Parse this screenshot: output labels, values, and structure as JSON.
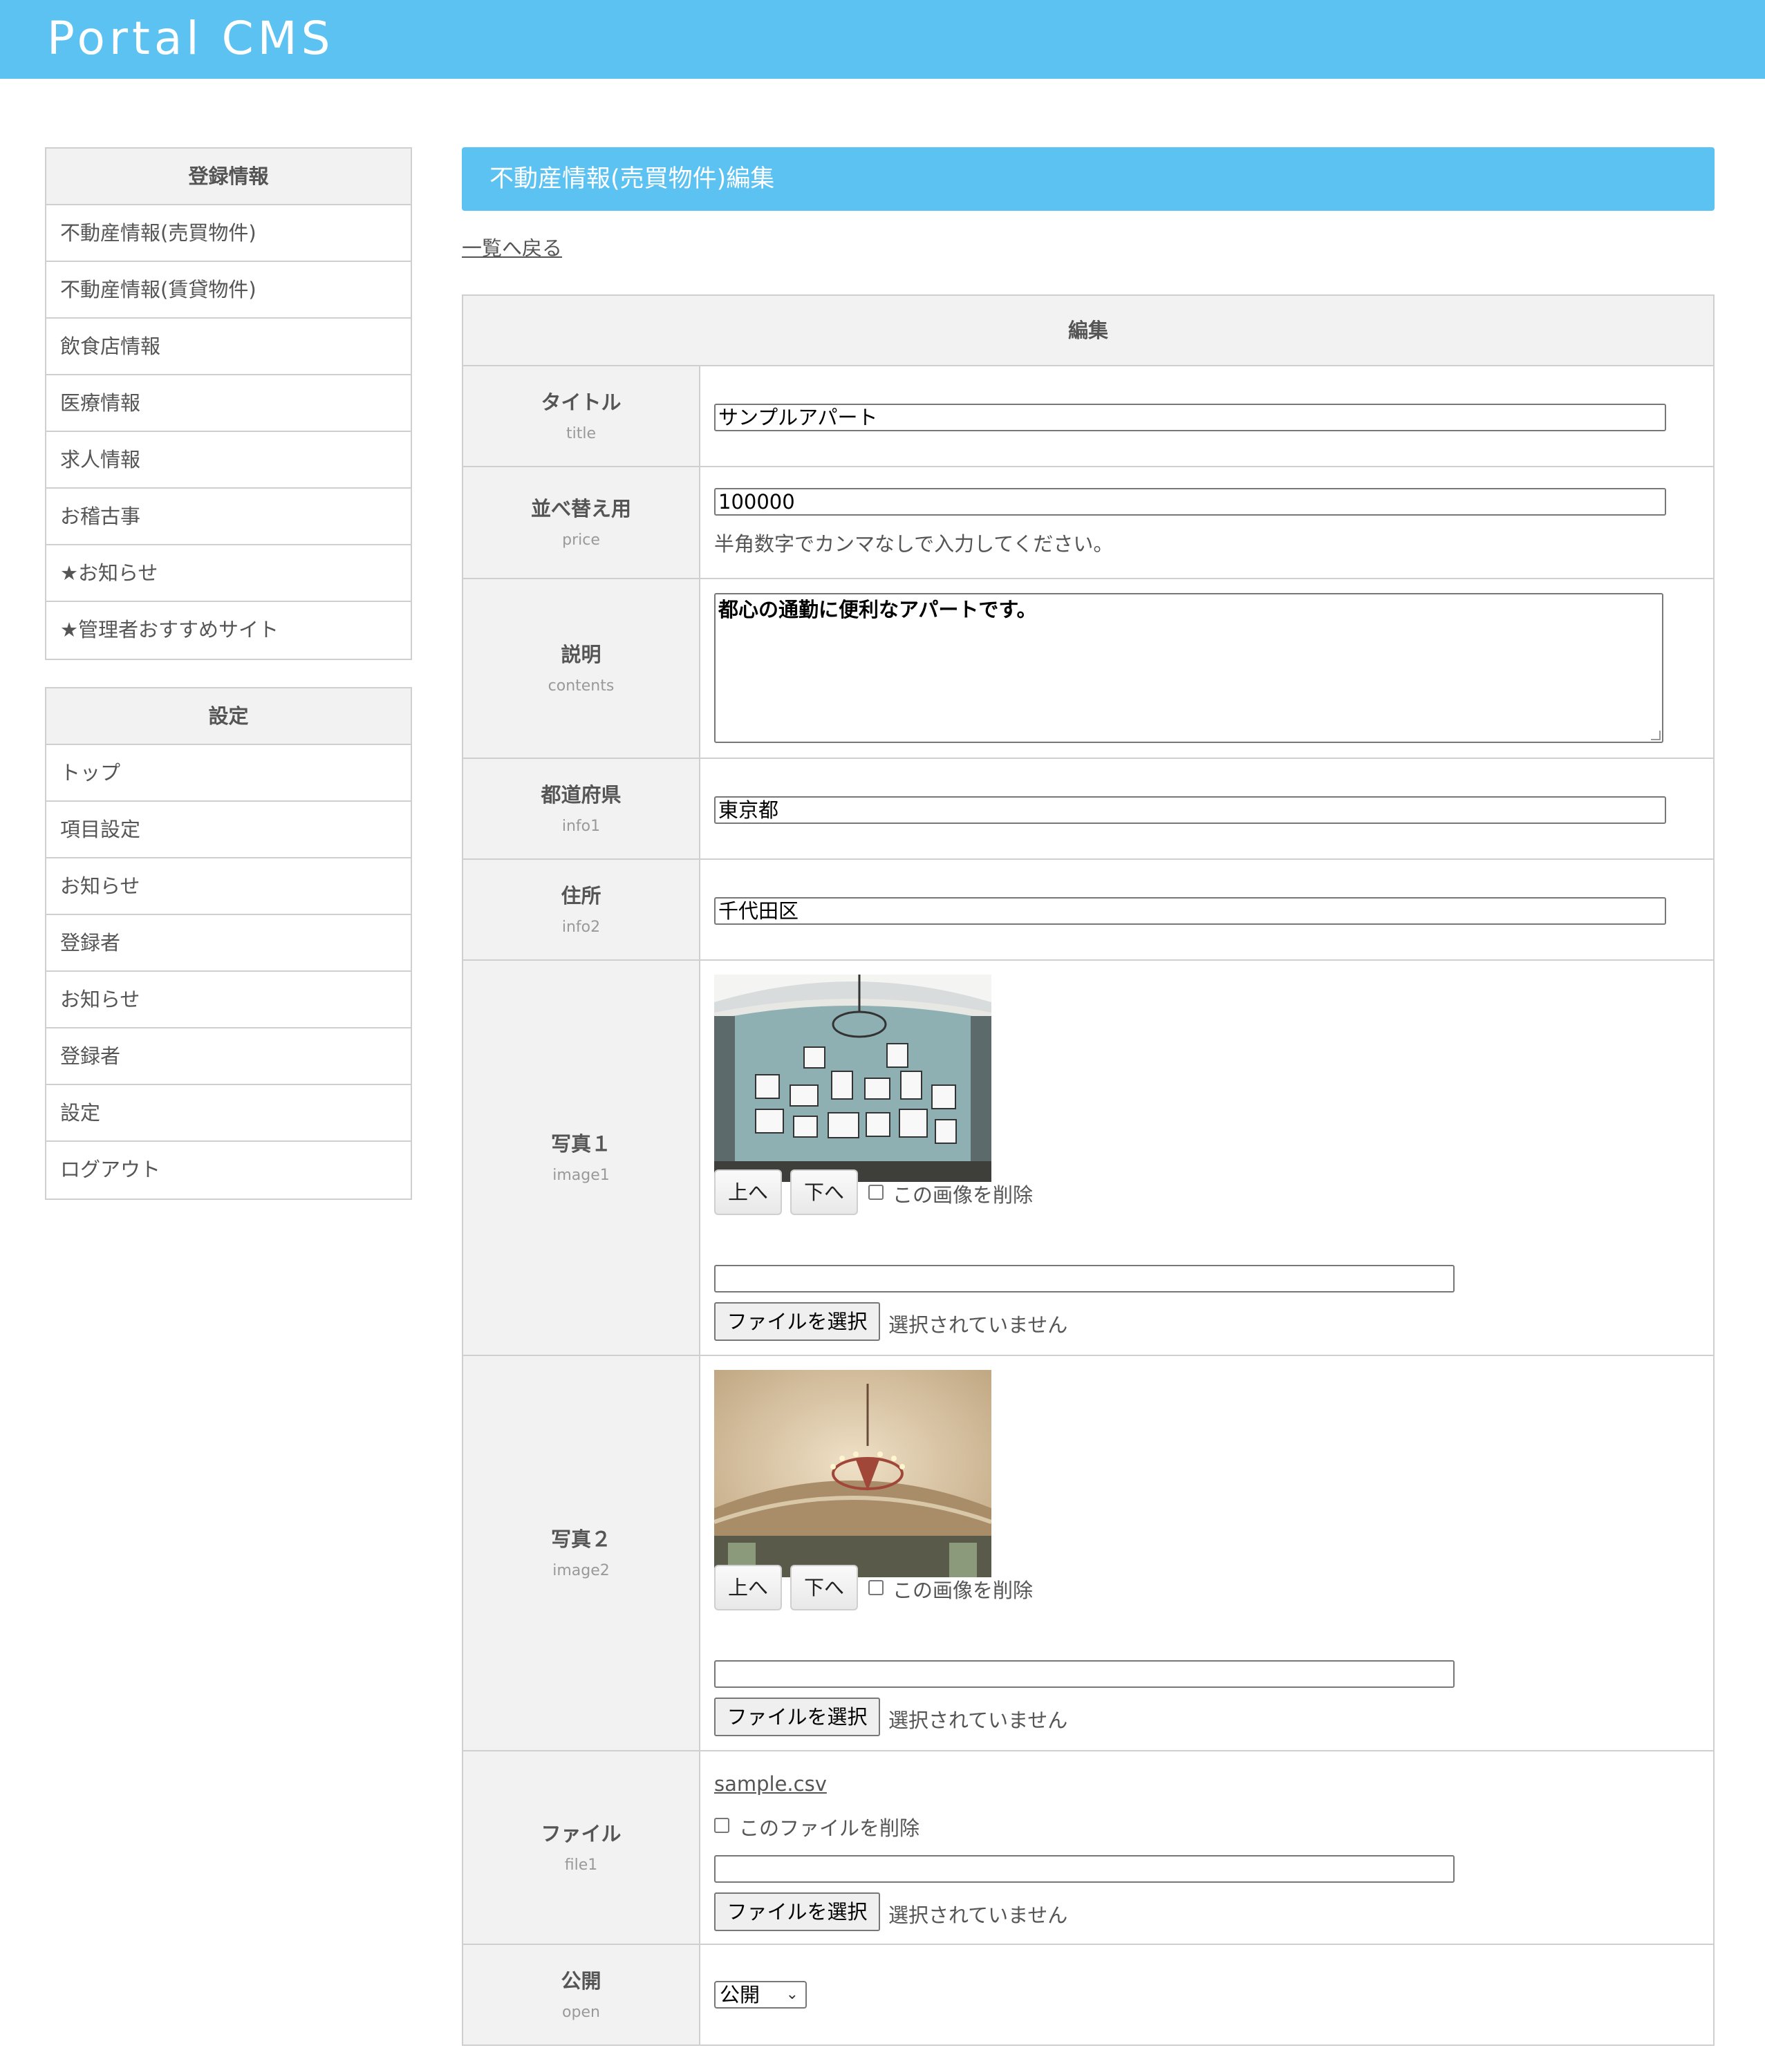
{
  "app": {
    "title": "Portal CMS"
  },
  "sidebar": {
    "registration": {
      "title": "登録情報",
      "items": [
        "不動産情報(売買物件)",
        "不動産情報(賃貸物件)",
        "飲食店情報",
        "医療情報",
        "求人情報",
        "お稽古事",
        "★お知らせ",
        "★管理者おすすめサイト"
      ]
    },
    "settings": {
      "title": "設定",
      "items": [
        "トップ",
        "項目設定",
        "お知らせ",
        "登録者",
        "お知らせ",
        "登録者",
        "設定",
        "ログアウト"
      ]
    }
  },
  "main": {
    "page_title": "不動産情報(売買物件)編集",
    "back_link": "一覧へ戻る",
    "form_header": "編集",
    "fields": {
      "title": {
        "label": "タイトル",
        "key": "title",
        "value": "サンプルアパート"
      },
      "price": {
        "label": "並べ替え用",
        "key": "price",
        "value": "100000",
        "hint": "半角数字でカンマなしで入力してください。"
      },
      "contents": {
        "label": "説明",
        "key": "contents",
        "value": "都心の通勤に便利なアパートです。"
      },
      "info1": {
        "label": "都道府県",
        "key": "info1",
        "value": "東京都"
      },
      "info2": {
        "label": "住所",
        "key": "info2",
        "value": "千代田区"
      },
      "image1": {
        "label": "写真１",
        "key": "image1"
      },
      "image2": {
        "label": "写真２",
        "key": "image2"
      },
      "file1": {
        "label": "ファイル",
        "key": "file1",
        "filename": "sample.csv",
        "delete_label": "このファイルを削除"
      },
      "open": {
        "label": "公開",
        "key": "open",
        "selected": "公開"
      }
    },
    "image_controls": {
      "up": "上へ",
      "down": "下へ",
      "delete": "この画像を削除",
      "choose_file": "ファイルを選択",
      "no_file": "選択されていません"
    }
  }
}
